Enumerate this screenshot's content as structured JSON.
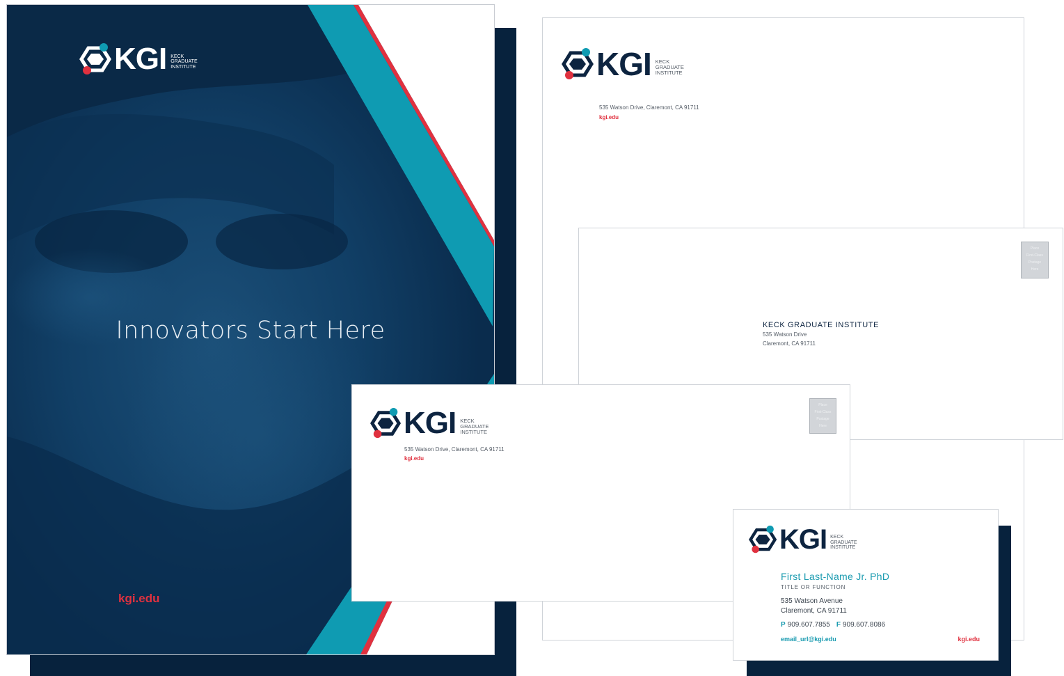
{
  "brand": {
    "name": "KGI",
    "subtitle_lines": [
      "KECK",
      "GRADUATE",
      "INSTITUTE"
    ],
    "colors": {
      "navy": "#0d2440",
      "teal": "#0f9bb2",
      "red": "#e0313f"
    }
  },
  "folder": {
    "headline": "Innovators Start Here",
    "url": "kgi.edu"
  },
  "letterhead": {
    "address": "535 Watson Drive, Claremont, CA 91711",
    "url": "kgi.edu"
  },
  "large_envelope": {
    "stamp_text": [
      "Place",
      "First-Class",
      "Postage",
      "Here"
    ],
    "recipient": {
      "name": "KECK GRADUATE INSTITUTE",
      "line1": "535 Watson Drive",
      "line2": "Claremont, CA 91711"
    }
  },
  "small_envelope": {
    "address": "535 Watson Drive, Claremont, CA 91711",
    "url": "kgi.edu",
    "stamp_text": [
      "Place",
      "First-Class",
      "Postage",
      "Here"
    ]
  },
  "business_card": {
    "name": "First Last-Name Jr. PhD",
    "title": "TITLE OR FUNCTION",
    "address_line1": "535 Watson Avenue",
    "address_line2": "Claremont, CA 91711",
    "phone_label": "P",
    "phone": "909.607.7855",
    "fax_label": "F",
    "fax": "909.607.8086",
    "email": "email_url@kgi.edu",
    "url": "kgi.edu"
  }
}
